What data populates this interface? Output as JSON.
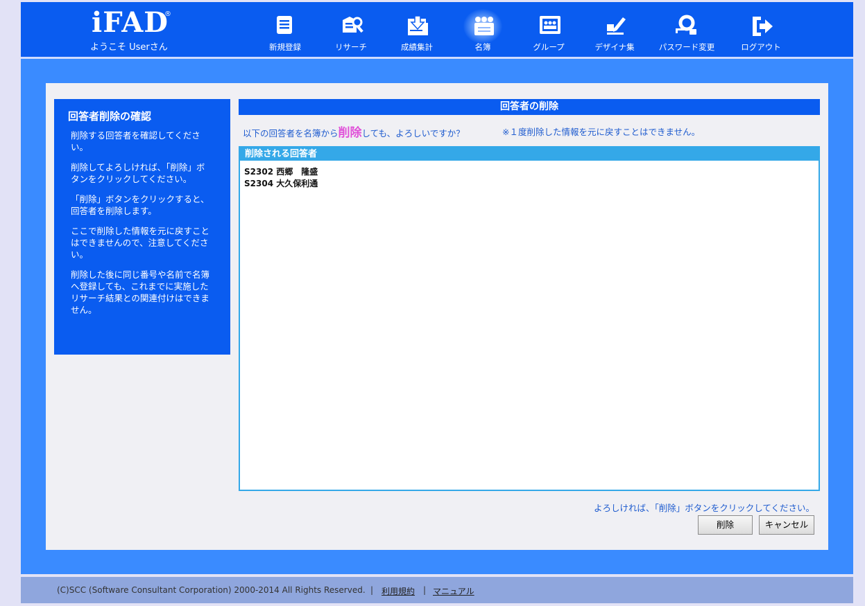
{
  "header": {
    "logo_text": "iFAD",
    "logo_reg": "®",
    "welcome": "ようこそ Userさん",
    "nav": [
      {
        "label": "新規登録",
        "icon": "document-icon"
      },
      {
        "label": "リサーチ",
        "icon": "research-icon"
      },
      {
        "label": "成績集計",
        "icon": "results-download-icon"
      },
      {
        "label": "名簿",
        "icon": "roster-icon",
        "active": true
      },
      {
        "label": "グループ",
        "icon": "group-icon"
      },
      {
        "label": "デザイナ集",
        "icon": "design-pen-icon"
      },
      {
        "label": "パスワード変更",
        "icon": "password-key-icon"
      },
      {
        "label": "ログアウト",
        "icon": "logout-icon"
      }
    ]
  },
  "sidebar": {
    "title": "回答者削除の確認",
    "paragraphs": [
      "削除する回答者を確認してください。",
      "削除してよろしければ、「削除」ボタンをクリックしてください。",
      "「削除」ボタンをクリックすると、回答者を削除します。",
      "ここで削除した情報を元に戻すことはできませんので、注意してください。",
      "削除した後に同じ番号や名前で名簿へ登録しても、これまでに実施したリサーチ結果との関連付けはできません。"
    ]
  },
  "main": {
    "title": "回答者の削除",
    "confirm_prefix": "以下の回答者を名簿から",
    "confirm_emph": "削除",
    "confirm_suffix": "しても、よろしいですか？",
    "confirm_note": "※１度削除した情報を元に戻すことはできません。",
    "list_title": "削除される回答者",
    "respondents": [
      "S2302 西郷　隆盛",
      "S2304 大久保利通"
    ],
    "bottom_message": "よろしければ、「削除」ボタンをクリックしてください。",
    "delete_button": "削除",
    "cancel_button": "キャンセル"
  },
  "footer": {
    "copyright": "(C)SCC (Software Consultant Corporation) 2000-2014 All Rights Reserved.",
    "sep": "|",
    "terms": "利用規約",
    "manual": "マニュアル"
  },
  "colors": {
    "header_blue": "#0a5cf0",
    "outer_blue": "#3a8bff",
    "accent_cyan": "#34a8e8",
    "emphasis_pink": "#e050d8",
    "text_blue": "#1f5ccf"
  }
}
